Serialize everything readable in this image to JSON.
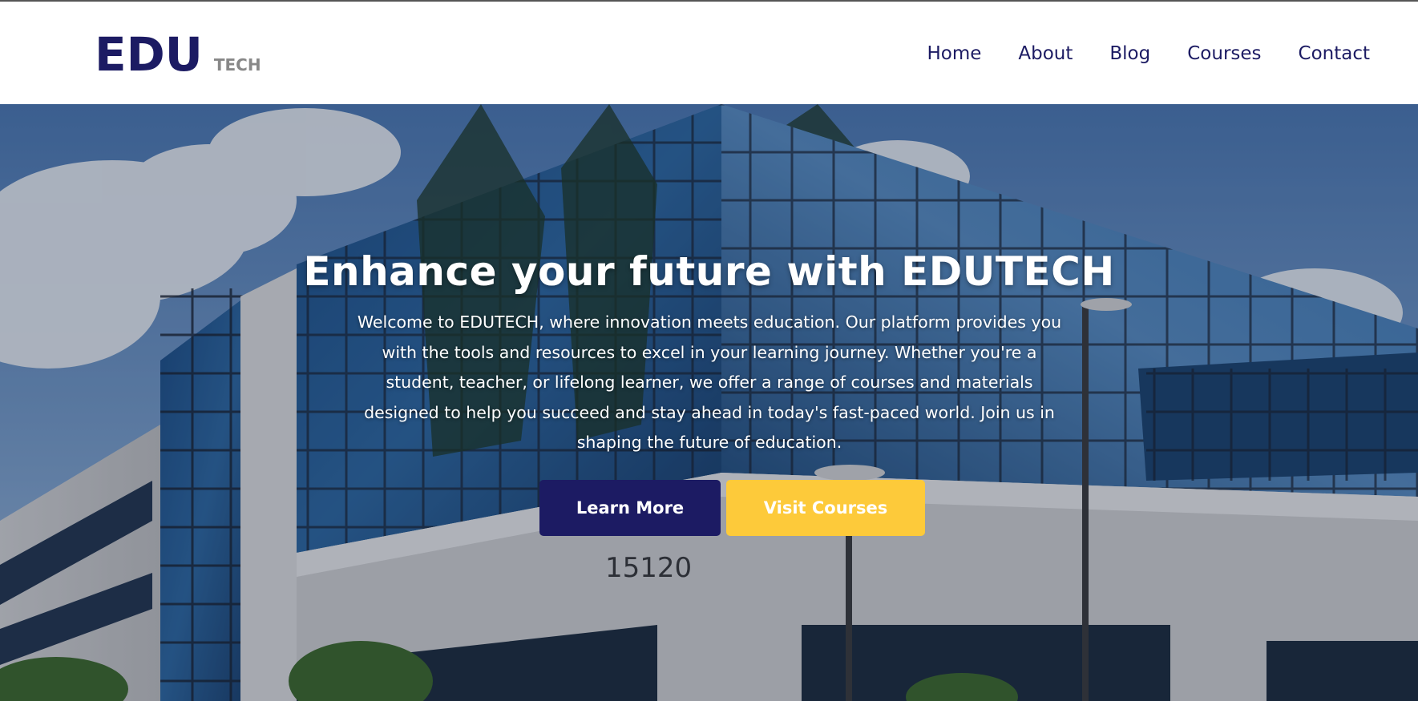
{
  "colors": {
    "brand_navy": "#1c1b63",
    "brand_yellow": "#fdca3a",
    "logo_sub_gray": "#888888",
    "nav_link": "#1c1b63",
    "hero_text": "#ffffff"
  },
  "header": {
    "logo_main": "EDU",
    "logo_sub": "TECH",
    "nav": [
      {
        "label": "Home"
      },
      {
        "label": "About"
      },
      {
        "label": "Blog"
      },
      {
        "label": "Courses"
      },
      {
        "label": "Contact"
      }
    ]
  },
  "hero": {
    "title": "Enhance your future with EDUTECH",
    "description": "Welcome to EDUTECH, where innovation meets education. Our platform provides you with the tools and resources to excel in your learning journey. Whether you're a student, teacher, or lifelong learner, we offer a range of courses and materials designed to help you succeed and stay ahead in today's fast-paced world. Join us in shaping the future of education.",
    "building_number": "15120",
    "buttons": {
      "learn_more": "Learn More",
      "visit_courses": "Visit Courses"
    }
  }
}
